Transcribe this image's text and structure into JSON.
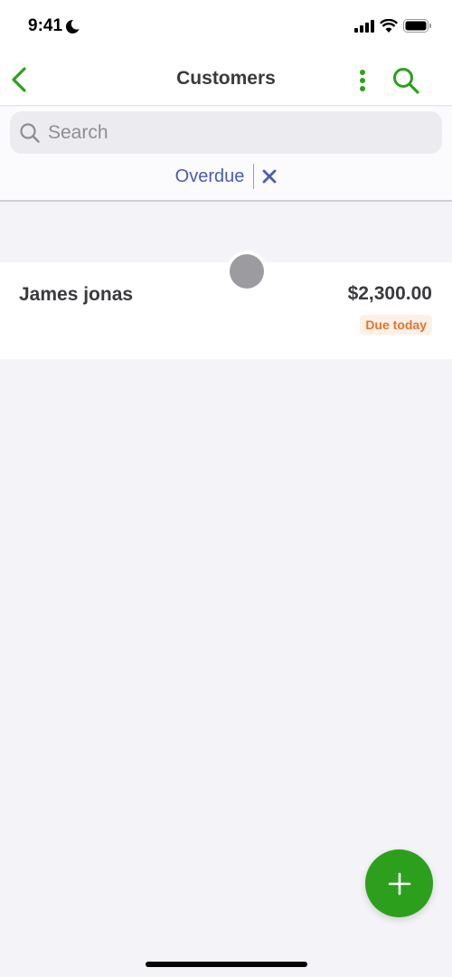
{
  "status_bar": {
    "time": "9:41",
    "icons": [
      "moon-icon",
      "cellular-signal-icon",
      "wifi-icon",
      "battery-icon"
    ]
  },
  "nav": {
    "title": "Customers",
    "back_icon": "chevron-left-icon",
    "more_icon": "more-vertical-icon",
    "search_icon": "search-icon",
    "accent_color": "#2ca01c"
  },
  "search": {
    "placeholder": "Search",
    "value": ""
  },
  "filter": {
    "label": "Overdue",
    "clear_icon": "close-icon",
    "color": "#4a5cb4"
  },
  "customers": [
    {
      "name": "James jonas",
      "amount": "$2,300.00",
      "status": "Due today",
      "status_color": "#e0752d"
    }
  ],
  "fab": {
    "icon": "plus-icon",
    "color": "#2ca01c"
  }
}
